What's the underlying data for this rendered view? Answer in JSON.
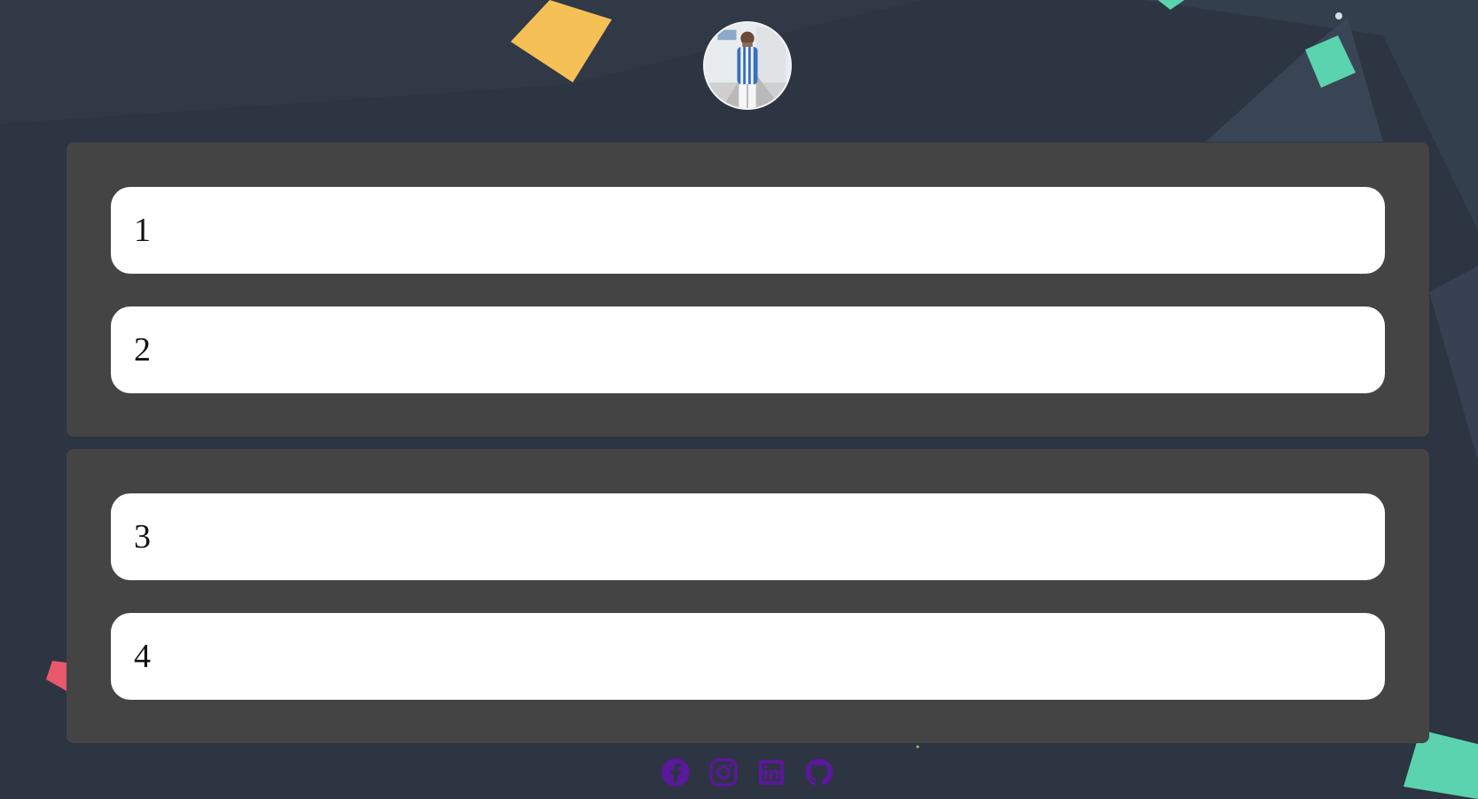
{
  "profile": {
    "avatar_icon": "profile-photo",
    "ring_color": "#f5f5f5"
  },
  "groups": [
    {
      "items": [
        {
          "label": "1"
        },
        {
          "label": "2"
        }
      ]
    },
    {
      "items": [
        {
          "label": "3"
        },
        {
          "label": "4"
        }
      ]
    }
  ],
  "social": {
    "icons": [
      "facebook-icon",
      "instagram-icon",
      "linkedin-icon",
      "github-icon"
    ],
    "color": "#5a189a"
  },
  "theme": {
    "background": "#2d3442",
    "panel": "#444444",
    "item": "#ffffff",
    "accent_yellow": "#f5c156",
    "accent_teal": "#5bd3ae",
    "accent_red": "#e8596b"
  }
}
